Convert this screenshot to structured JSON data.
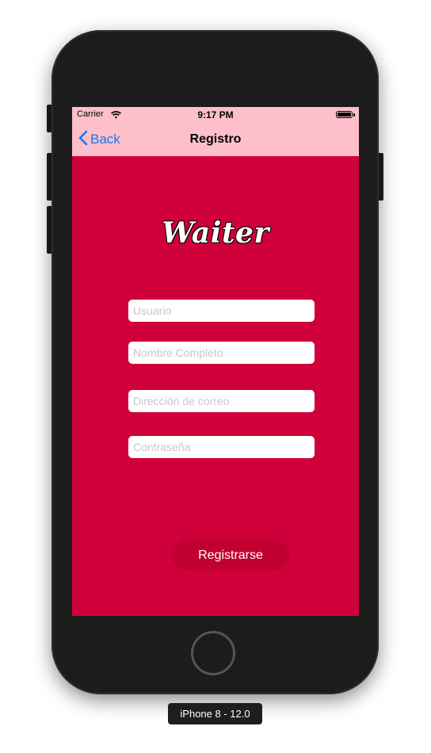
{
  "status_bar": {
    "carrier": "Carrier",
    "time": "9:17 PM"
  },
  "nav": {
    "back_label": "Back",
    "title": "Registro"
  },
  "logo": {
    "text": "Waiter"
  },
  "form": {
    "username_placeholder": "Usuario",
    "fullname_placeholder": "Nombre Completo",
    "email_placeholder": "Dirección de correo",
    "password_placeholder": "Contraseña"
  },
  "register_button": {
    "label": "Registrarse"
  },
  "device_label": "iPhone 8 - 12.0",
  "colors": {
    "background": "#d0003a",
    "nav_bar": "#fdc0cb",
    "back_tint": "#1578f5",
    "button": "#c20030"
  },
  "icons": [
    "wifi-icon",
    "battery-icon",
    "chevron-left-icon"
  ]
}
